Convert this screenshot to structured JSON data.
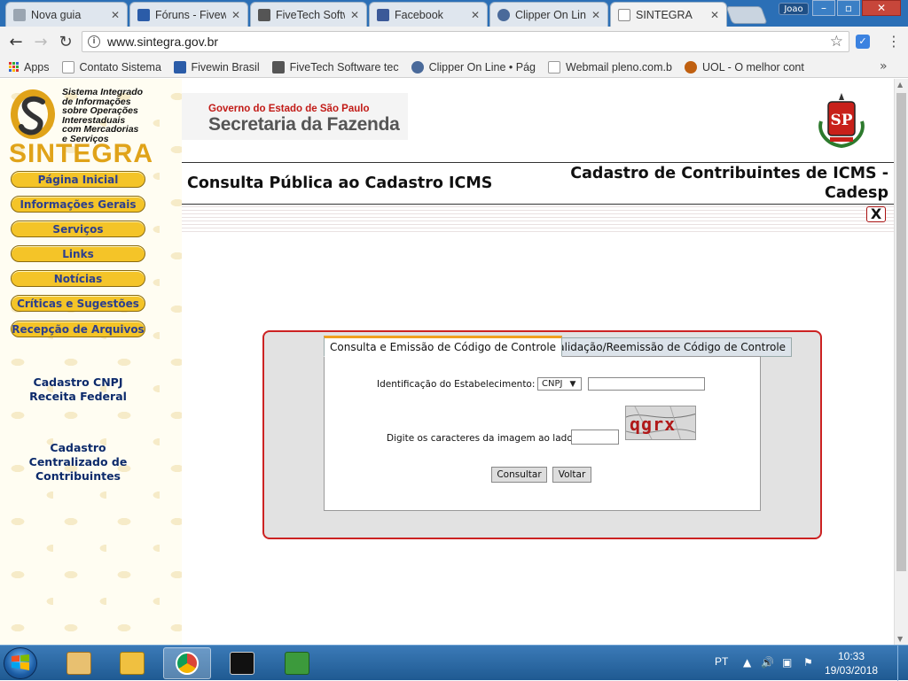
{
  "browser": {
    "tabs": [
      {
        "title": "Nova guia",
        "favicon": "page-icon",
        "color": "#9aa5b1"
      },
      {
        "title": "Fóruns - Fivewin",
        "favicon": "fivewin-icon",
        "color": "#2b5ca8"
      },
      {
        "title": "FiveTech Software",
        "favicon": "fivetech-icon",
        "color": "#555555"
      },
      {
        "title": "Facebook",
        "favicon": "facebook-icon",
        "color": "#3b5998"
      },
      {
        "title": "Clipper On Line",
        "favicon": "clipper-icon",
        "color": "#4a6a9a"
      },
      {
        "title": "SINTEGRA",
        "favicon": "page-icon",
        "color": "#9aa5b1",
        "active": true
      }
    ],
    "tab_close": "✕",
    "user_badge": "Joao",
    "window_buttons": {
      "minimize": "–",
      "maximize": "▫",
      "close": "✕"
    },
    "nav": {
      "back": "←",
      "forward": "→",
      "reload": "↻"
    },
    "url": "www.sintegra.gov.br",
    "info_icon": "i",
    "star": "☆",
    "menu": "⋮",
    "bookmarks": [
      {
        "label": "Apps",
        "icon": "apps-grid-icon",
        "color": "#d33"
      },
      {
        "label": "Contato Sistemas",
        "icon": "page-icon",
        "color": "#9aa5b1"
      },
      {
        "label": "Fivewin Brasil",
        "icon": "fivewin-icon",
        "color": "#2b5ca8"
      },
      {
        "label": "FiveTech Software tec",
        "icon": "fivetech-icon",
        "color": "#555555"
      },
      {
        "label": "Clipper On Line • Pág",
        "icon": "clipper-icon",
        "color": "#4a6a9a"
      },
      {
        "label": "Webmail pleno.com.b",
        "icon": "page-icon",
        "color": "#9aa5b1"
      },
      {
        "label": "UOL - O melhor cont",
        "icon": "uol-icon",
        "color": "#c06010"
      }
    ],
    "bookmarks_more": "»"
  },
  "sidebar": {
    "logo_lines": [
      "Sistema Integrado",
      "de Informações",
      "sobre Operações",
      "Interestaduais",
      "com Mercadorias",
      "e Serviços"
    ],
    "logo_word": "SINTEGRA",
    "menu": [
      "Página Inicial",
      "Informações Gerais",
      "Serviços",
      "Links",
      "Notícias",
      "Críticas e Sugestões",
      "Recepção de Arquivos"
    ],
    "link_cnpj": [
      "Cadastro CNPJ",
      "Receita Federal"
    ],
    "link_cadastro": [
      "Cadastro",
      "Centralizado de",
      "Contribuintes"
    ]
  },
  "header": {
    "gov_line1": "Governo do Estado de São Paulo",
    "gov_line2": "Secretaria da Fazenda",
    "crest_letters": "SP",
    "page_title": "Consulta Pública ao Cadastro ICMS",
    "cadesp_title": [
      "Cadastro de Contribuintes de ICMS -",
      "Cadesp"
    ],
    "close_x": "X"
  },
  "form": {
    "tabs": [
      {
        "label": "Consulta e Emissão de Código de Controle",
        "active": true
      },
      {
        "label": "Validação/Reemissão de Código de Controle",
        "active": false
      }
    ],
    "ident_label": "Identificação do Estabelecimento:",
    "ident_type": "CNPJ",
    "ident_value": "",
    "captcha_label": "Digite os caracteres da imagem ao lado:",
    "captcha_text": "qgrx",
    "captcha_value": "",
    "consultar": "Consultar",
    "voltar": "Voltar"
  },
  "taskbar": {
    "apps": [
      {
        "icon": "outlook-icon",
        "color": "#e8c070"
      },
      {
        "icon": "explorer-icon",
        "color": "#f0c040"
      },
      {
        "icon": "chrome-icon",
        "color": "#4a90d9",
        "active": true
      },
      {
        "icon": "cmd-icon",
        "color": "#111111"
      },
      {
        "icon": "notepad-icon",
        "color": "#3c9a3c"
      }
    ],
    "lang": "PT",
    "time": "10:33",
    "date": "19/03/2018"
  }
}
